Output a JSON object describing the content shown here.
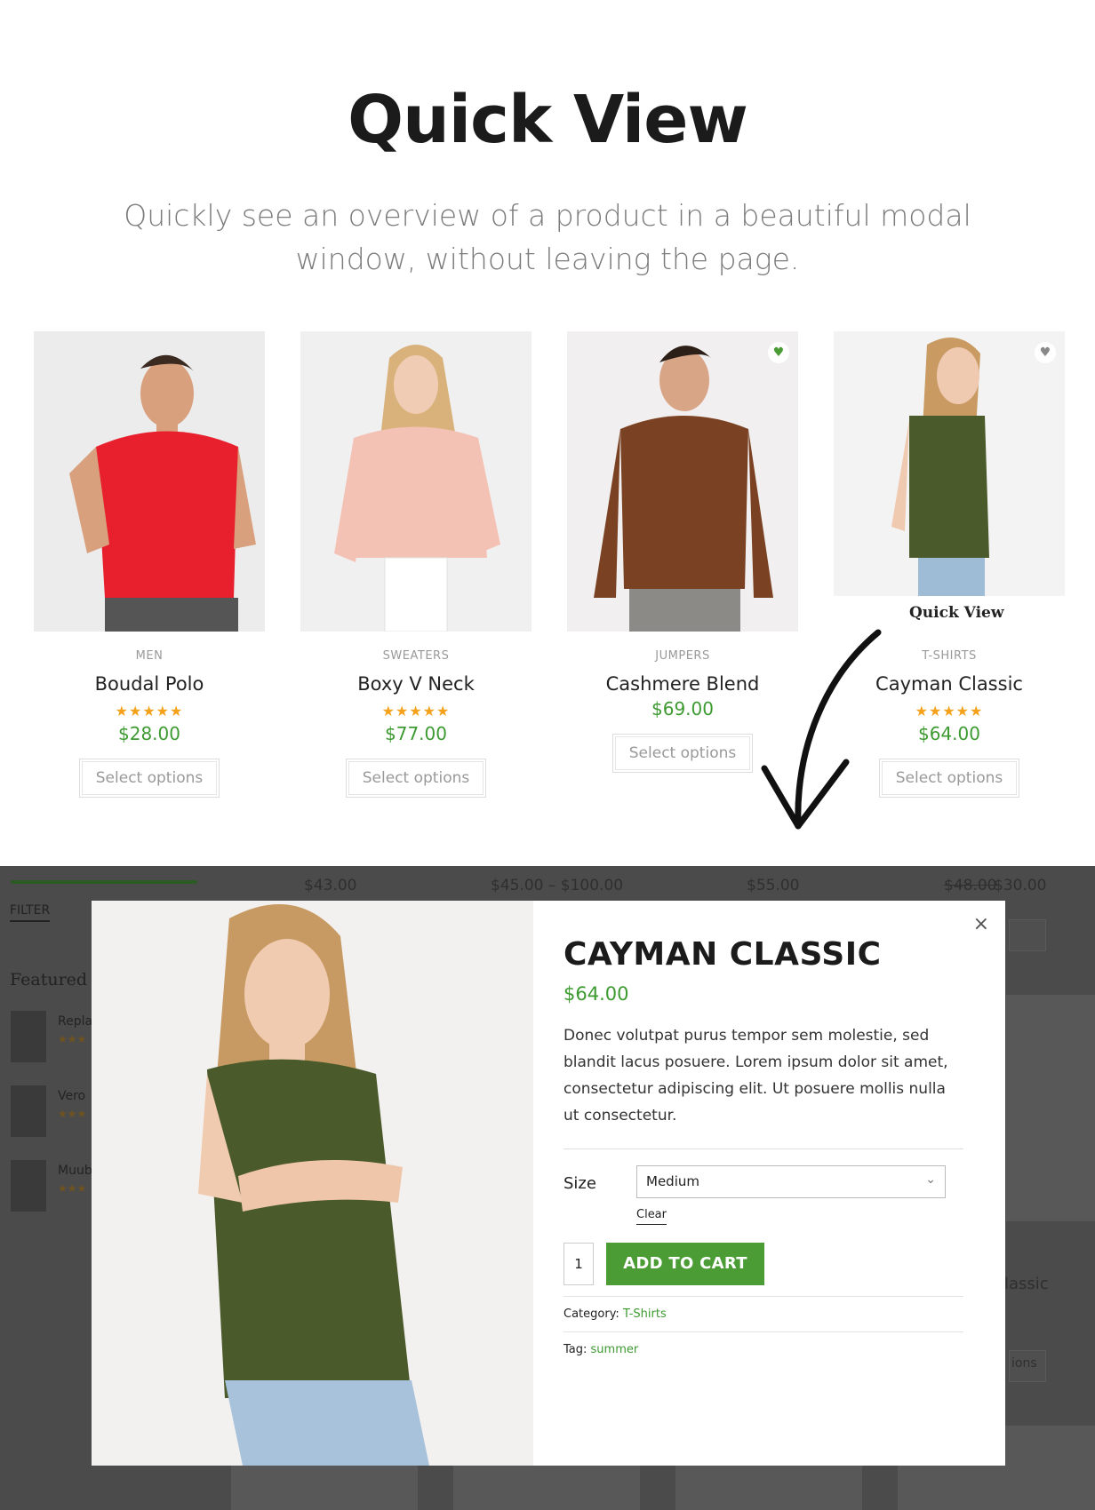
{
  "hero": {
    "title": "Quick View",
    "subtitle": "Quickly see an overview of a product in a beautiful modal window, without leaving the page."
  },
  "products": [
    {
      "category": "MEN",
      "name": "Boudal Polo",
      "stars": "★★★★★",
      "rating": 4.5,
      "price": "$28.00",
      "button": "Select options",
      "shirt_color": "#e8202e"
    },
    {
      "category": "SWEATERS",
      "name": "Boxy V Neck",
      "stars": "★★★★★",
      "rating": 4.5,
      "price": "$77.00",
      "button": "Select options",
      "shirt_color": "#f4c2b5"
    },
    {
      "category": "JUMPERS",
      "name": "Cashmere Blend",
      "stars": "",
      "price": "$69.00",
      "button": "Select options",
      "shirt_color": "#7a4223"
    },
    {
      "category": "T-SHIRTS",
      "name": "Cayman Classic",
      "stars": "★★★★★",
      "rating": 4.5,
      "price": "$64.00",
      "button": "Select options",
      "shirt_color": "#4b5a2a"
    }
  ],
  "quick_view_label": "Quick View",
  "background": {
    "prices": [
      "$43.00",
      "$45.00 – $100.00",
      "$55.00",
      "$48.00",
      "$30.00"
    ],
    "filter": "FILTER",
    "featured": "Featured",
    "featured_items": [
      "Replay",
      "Vero",
      "Muub"
    ],
    "partial_name": "lassic",
    "partial_button": "ions"
  },
  "modal": {
    "close": "×",
    "title": "CAYMAN CLASSIC",
    "price": "$64.00",
    "description": "Donec volutpat purus tempor sem molestie, sed blandit lacus posuere. Lorem ipsum dolor sit amet, consectetur adipiscing elit. Ut posuere mollis nulla ut consectetur.",
    "size_label": "Size",
    "size_value": "Medium",
    "clear": "Clear",
    "quantity": "1",
    "add_to_cart": "ADD TO CART",
    "category_label": "Category:",
    "category_value": "T-Shirts",
    "tag_label": "Tag:",
    "tag_value": "summer"
  },
  "colors": {
    "accent_green": "#3d9a31",
    "button_green": "#4c9c36",
    "star": "#f4a11b",
    "overlay": "#4b4b4b"
  },
  "icons": [
    "heart-icon",
    "close-icon",
    "chevron-down-icon",
    "arrow-icon"
  ]
}
